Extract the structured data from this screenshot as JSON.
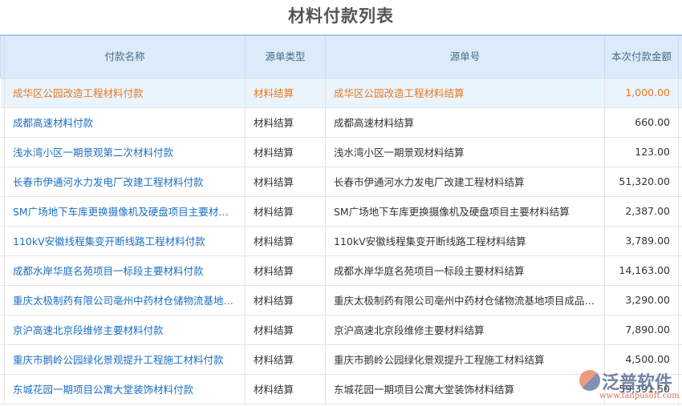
{
  "title": "材料付款列表",
  "headers": [
    "付款名称",
    "源单类型",
    "源单号",
    "本次付款金额"
  ],
  "rows": [
    {
      "name": "成华区公园改造工程材料付款",
      "type": "材料结算",
      "source": "成华区公园改造工程材料结算",
      "amount": "1,000.00"
    },
    {
      "name": "成都高速材料付款",
      "type": "材料结算",
      "source": "成都高速材料结算",
      "amount": "660.00"
    },
    {
      "name": "浅水湾小区一期景观第二次材料付款",
      "type": "材料结算",
      "source": "浅水湾小区一期景观材料结算",
      "amount": "123.00"
    },
    {
      "name": "长春市伊通河水力发电厂改建工程材料付款",
      "type": "材料结算",
      "source": "长春市伊通河水力发电厂改建工程材料结算",
      "amount": "51,320.00"
    },
    {
      "name": "SM广场地下车库更换摄像机及硬盘项目主要材料付款",
      "type": "材料结算",
      "source": "SM广场地下车库更换摄像机及硬盘项目主要材料结算",
      "amount": "2,387.00"
    },
    {
      "name": "110kV安徽线程集变开断线路工程材料付款",
      "type": "材料结算",
      "source": "110kV安徽线程集变开断线路工程材料结算",
      "amount": "3,789.00"
    },
    {
      "name": "成都水岸华庭名苑项目一标段主要材料付款",
      "type": "材料结算",
      "source": "成都水岸华庭名苑项目一标段主要材料结算",
      "amount": "14,163.00"
    },
    {
      "name": "重庆太极制药有限公司亳州中药材仓储物流基地项目材料付款",
      "type": "材料结算",
      "source": "重庆太极制药有限公司亳州中药材仓储物流基地项目成品材料结算",
      "amount": "3,290.00"
    },
    {
      "name": "京沪高速北京段维修主要材料付款",
      "type": "材料结算",
      "source": "京沪高速北京段维修主要材料结算",
      "amount": "7,890.00"
    },
    {
      "name": "重庆市鹅岭公园绿化景观提升工程施工材料付款",
      "type": "材料结算",
      "source": "重庆市鹅岭公园绿化景观提升工程施工材料结算",
      "amount": "4,500.00"
    },
    {
      "name": "东城花园一期项目公寓大堂装饰材料付款",
      "type": "材料结算",
      "source": "东城花园一期项目公寓大堂装饰材料结算",
      "amount": "59,391.50"
    }
  ],
  "watermark": {
    "cn": "泛普软件",
    "url": "www.fanpusoft.com"
  }
}
